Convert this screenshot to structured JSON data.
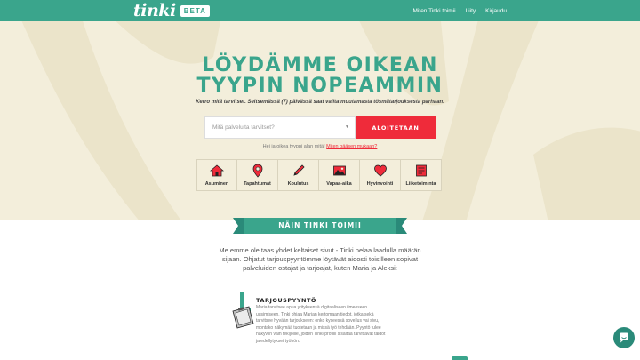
{
  "header": {
    "logo_text": "tinki",
    "logo_badge": "BETA",
    "nav": [
      "Miten Tinki toimii",
      "Liity",
      "Kirjaudu"
    ]
  },
  "hero": {
    "title_line1": "LÖYDÄMME OIKEAN",
    "title_line2": "TYYPIN NOPEAMMIN",
    "subtitle": "Kerro mitä tarvitset. Seitsemässä (7) päivässä saat valita muutamasta tösmätarjouksesta parhaan.",
    "search_placeholder": "Mitä palveluita tarvitset?",
    "start_button": "ALOITETAAN",
    "help_prefix": "Hei ja oikea tyyppi alan mitä!",
    "help_link": "Miten pääsen mukaan?"
  },
  "categories": [
    {
      "label": "Asuminen",
      "icon": "house-icon"
    },
    {
      "label": "Tapahtumat",
      "icon": "location-pin-icon"
    },
    {
      "label": "Koulutus",
      "icon": "pencil-icon"
    },
    {
      "label": "Vapaa-aika",
      "icon": "picture-icon"
    },
    {
      "label": "Hyvinvointi",
      "icon": "heart-icon"
    },
    {
      "label": "Liiketoiminta",
      "icon": "document-icon"
    }
  ],
  "how_it_works": {
    "ribbon": "NÄIN TINKI TOIMII",
    "intro": "Me emme ole taas yhdet keltaiset sivut - Tinki pelaa laadulla määrän sijaan. Ohjatut tarjouspyyntömme löytävät aidosti toisilleen sopivat palveluiden ostajat ja tarjoajat, kuten Maria ja Aleksi:",
    "step_title": "TARJOUSPYYNTÖ",
    "step_text": "Maria tarvitsee apua yrityksensä digitaaliseen ilmeeseen uusimiseen. Tinki ohjaa Marian kertomaan tiedot, jotka sekä tarvitsee hyvään tarjoukseen: onko kyseessä sovellus vai sivu, montako näkymää tuotetaan ja missä työ tehdään. Pyyntö tulee näkyviin vain tekijöille, joiden Tinki-profiili sisältää tarvittavat taidot ja edellytykset työhön."
  },
  "colors": {
    "brand_green": "#3aa58c",
    "accent_red": "#ef2b3a",
    "hero_bg": "#f3eedb"
  },
  "chat_icon": "chat-bubble-icon"
}
